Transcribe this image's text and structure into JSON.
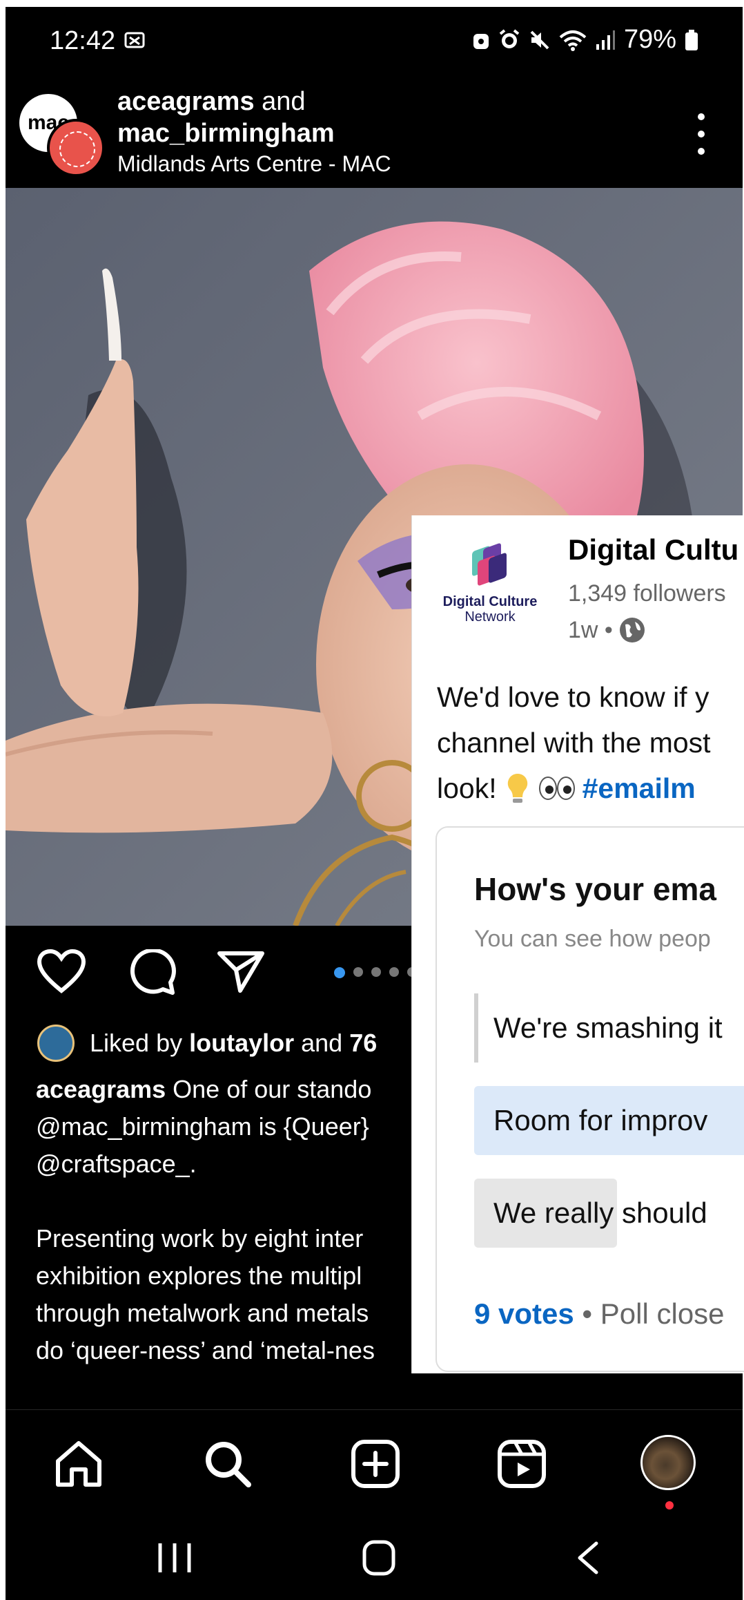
{
  "status_bar": {
    "time": "12:42",
    "battery": "79%"
  },
  "post_header": {
    "account1": "aceagrams",
    "connector": " and",
    "account2": "mac_birmingham",
    "location": "Midlands Arts Centre - MAC",
    "avatar_text": "mac"
  },
  "likes": {
    "prefix": "Liked by ",
    "user": "loutaylor",
    "suffix": " and ",
    "count": "76"
  },
  "caption": {
    "author": "aceagrams",
    "line1": " One of our stando",
    "rest": "@mac_birmingham is {Queer}\n@craftspace_.\n\nPresenting work by eight inter\nexhibition explores the multipl\nthrough metalwork and metals\ndo ‘queer-ness’ and ‘metal-nes"
  },
  "carousel": {
    "count": 5,
    "active": 0
  },
  "nav": {
    "items": [
      "home-icon",
      "search-icon",
      "create-icon",
      "reels-icon",
      "profile-avatar"
    ]
  },
  "overlay": {
    "org_name": "Digital Cultu",
    "logo_line1": "Digital Culture",
    "logo_line2": "Network",
    "followers": "1,349 followers",
    "time": "1w •",
    "post_line1": "We'd love to know if y",
    "post_line2": "channel with the most",
    "post_line3": "look! ",
    "hashtag": "#emailm",
    "poll_question": "How's your ema",
    "poll_sub": "You can see how peop",
    "options": [
      "We're smashing it",
      "Room for improv",
      "We really should"
    ],
    "option3_fill": 0.37,
    "votes": "9 votes",
    "poll_status": " • Poll close"
  },
  "colors": {
    "instagram_blue": "#3897f0",
    "linkedin_blue": "#0a66c2",
    "poll_highlight": "#dce9f9"
  }
}
